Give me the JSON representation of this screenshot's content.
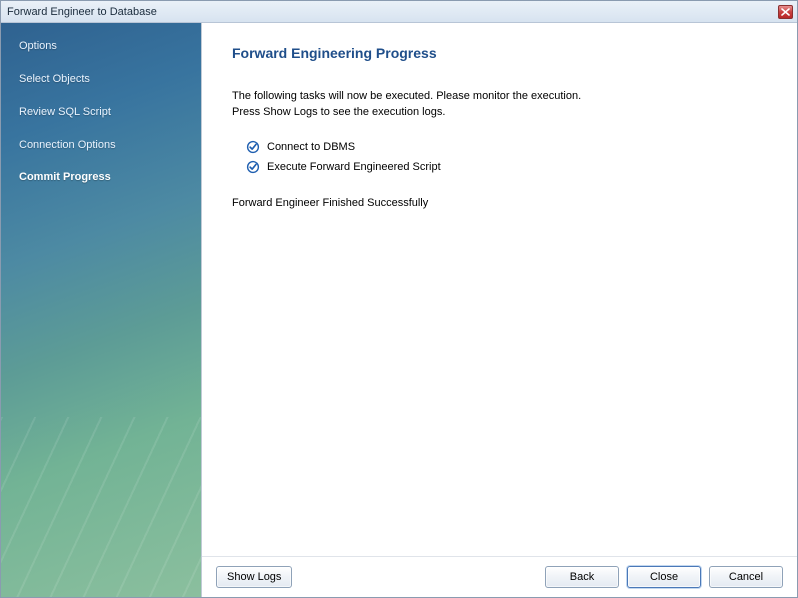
{
  "window": {
    "title": "Forward Engineer to Database"
  },
  "sidebar": {
    "items": [
      {
        "label": "Options"
      },
      {
        "label": "Select Objects"
      },
      {
        "label": "Review SQL Script"
      },
      {
        "label": "Connection Options"
      },
      {
        "label": "Commit Progress"
      }
    ],
    "active_index": 4
  },
  "main": {
    "heading": "Forward Engineering Progress",
    "intro_line1": "The following tasks will now be executed. Please monitor the execution.",
    "intro_line2": "Press Show Logs to see the execution logs.",
    "tasks": [
      {
        "label": "Connect to DBMS",
        "status": "done"
      },
      {
        "label": "Execute Forward Engineered Script",
        "status": "done"
      }
    ],
    "result_text": "Forward Engineer Finished Successfully"
  },
  "footer": {
    "show_logs_label": "Show Logs",
    "back_label": "Back",
    "close_label": "Close",
    "cancel_label": "Cancel"
  },
  "icons": {
    "check_color": "#1f5fb0"
  }
}
